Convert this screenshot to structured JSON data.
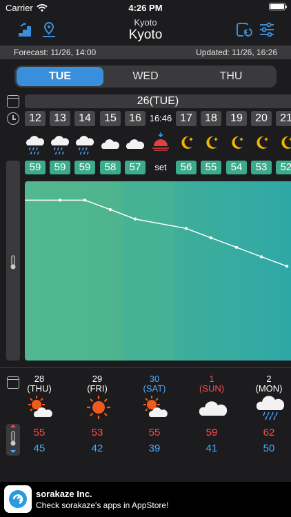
{
  "status": {
    "carrier": "Carrier",
    "time": "4:26 PM"
  },
  "nav": {
    "subtitle": "Kyoto",
    "title": "Kyoto"
  },
  "info": {
    "forecast": "Forecast: 11/26, 14:00",
    "updated": "Updated: 11/26, 16:26"
  },
  "tabs": [
    "TUE",
    "WED",
    "THU"
  ],
  "day_header": "26(TUE)",
  "hours": [
    "12",
    "13",
    "14",
    "15",
    "16",
    "16:46",
    "17",
    "18",
    "19",
    "20",
    "21"
  ],
  "temps": [
    "59",
    "59",
    "59",
    "58",
    "57",
    "set",
    "56",
    "55",
    "54",
    "53",
    "52"
  ],
  "weather_icons": [
    "rain-cloud-icon",
    "rain-cloud-icon",
    "rain-cloud-icon",
    "cloud-icon",
    "cloud-icon",
    "sunset-icon",
    "moon-icon",
    "moon-icon",
    "moon-icon",
    "moon-icon",
    "moon-icon"
  ],
  "colors": {
    "accent": "#3a8fdc",
    "temp_badge": "#3cab8c",
    "high": "#ff4d4d",
    "low": "#4aa8ff",
    "saturday": "#4aa8ff",
    "sunday": "#ff4d4d"
  },
  "weekly": [
    {
      "date": "28",
      "dow": "(THU)",
      "hi": "55",
      "lo": "45",
      "icon": "sun-cloud-icon",
      "color": "#ffffff"
    },
    {
      "date": "29",
      "dow": "(FRI)",
      "hi": "53",
      "lo": "42",
      "icon": "sun-icon",
      "color": "#ffffff"
    },
    {
      "date": "30",
      "dow": "(SAT)",
      "hi": "55",
      "lo": "39",
      "icon": "sun-cloud-icon",
      "color": "#4aa8ff"
    },
    {
      "date": "1",
      "dow": "(SUN)",
      "hi": "59",
      "lo": "41",
      "icon": "cloud-icon",
      "color": "#ff4d4d"
    },
    {
      "date": "2",
      "dow": "(MON)",
      "hi": "62",
      "lo": "50",
      "icon": "rain-cloud-icon",
      "color": "#ffffff"
    }
  ],
  "chart_data": {
    "type": "line",
    "x": [
      "12",
      "13",
      "14",
      "15",
      "16",
      "17",
      "18",
      "19",
      "20",
      "21"
    ],
    "values": [
      59,
      59,
      59,
      58,
      57,
      56,
      55,
      54,
      53,
      52
    ],
    "ylim": [
      42,
      61
    ]
  },
  "ad": {
    "title": "sorakaze Inc.",
    "text": "Check sorakaze's apps in AppStore!"
  }
}
